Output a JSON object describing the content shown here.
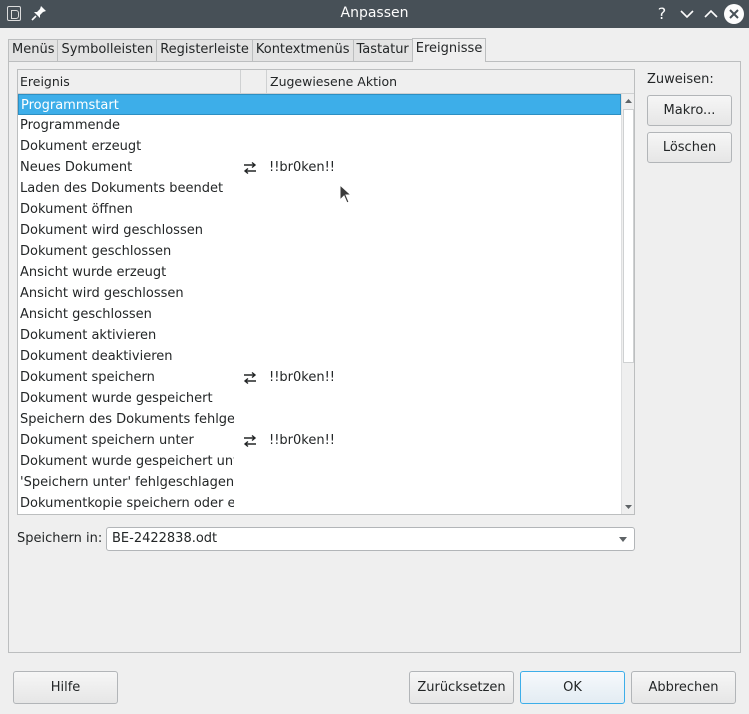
{
  "window": {
    "title": "Anpassen",
    "help_glyph": "?"
  },
  "tabs": [
    {
      "label": "Menüs"
    },
    {
      "label": "Symbolleisten"
    },
    {
      "label": "Registerleiste"
    },
    {
      "label": "Kontextmenüs"
    },
    {
      "label": "Tastatur"
    },
    {
      "label": "Ereignisse",
      "active": true
    }
  ],
  "table": {
    "headers": {
      "event": "Ereignis",
      "action": "Zugewiesene Aktion"
    },
    "rows": [
      {
        "event": "Programmstart",
        "action": "",
        "icon": "",
        "selected": true
      },
      {
        "event": "Programmende",
        "action": "",
        "icon": ""
      },
      {
        "event": "Dokument erzeugt",
        "action": "",
        "icon": ""
      },
      {
        "event": "Neues Dokument",
        "action": "!!br0ken!!",
        "icon": "macro-assign-icon"
      },
      {
        "event": "Laden des Dokuments beendet",
        "action": "",
        "icon": ""
      },
      {
        "event": "Dokument öffnen",
        "action": "",
        "icon": ""
      },
      {
        "event": "Dokument wird geschlossen",
        "action": "",
        "icon": ""
      },
      {
        "event": "Dokument geschlossen",
        "action": "",
        "icon": ""
      },
      {
        "event": "Ansicht wurde erzeugt",
        "action": "",
        "icon": ""
      },
      {
        "event": "Ansicht wird geschlossen",
        "action": "",
        "icon": ""
      },
      {
        "event": "Ansicht geschlossen",
        "action": "",
        "icon": ""
      },
      {
        "event": "Dokument aktivieren",
        "action": "",
        "icon": ""
      },
      {
        "event": "Dokument deaktivieren",
        "action": "",
        "icon": ""
      },
      {
        "event": "Dokument speichern",
        "action": "!!br0ken!!",
        "icon": "macro-assign-icon"
      },
      {
        "event": "Dokument wurde gespeichert",
        "action": "",
        "icon": ""
      },
      {
        "event": "Speichern des Dokuments fehlgeschlagen",
        "action": "",
        "icon": ""
      },
      {
        "event": "Dokument speichern unter",
        "action": "!!br0ken!!",
        "icon": "macro-assign-icon"
      },
      {
        "event": "Dokument wurde gespeichert unter",
        "action": "",
        "icon": ""
      },
      {
        "event": "'Speichern unter' fehlgeschlagen",
        "action": "",
        "icon": ""
      },
      {
        "event": "Dokumentkopie speichern oder exportieren",
        "action": "",
        "icon": ""
      }
    ],
    "scroll_fraction": 0
  },
  "assign": {
    "label": "Zuweisen:",
    "macro_button": "Makro...",
    "delete_button": "Löschen"
  },
  "save_in": {
    "label": "Speichern in:",
    "value": "BE-2422838.odt"
  },
  "footer": {
    "help": "Hilfe",
    "reset": "Zurücksetzen",
    "ok": "OK",
    "cancel": "Abbrechen"
  },
  "colors": {
    "selection": "#3daee9",
    "titlebar": "#475057"
  }
}
